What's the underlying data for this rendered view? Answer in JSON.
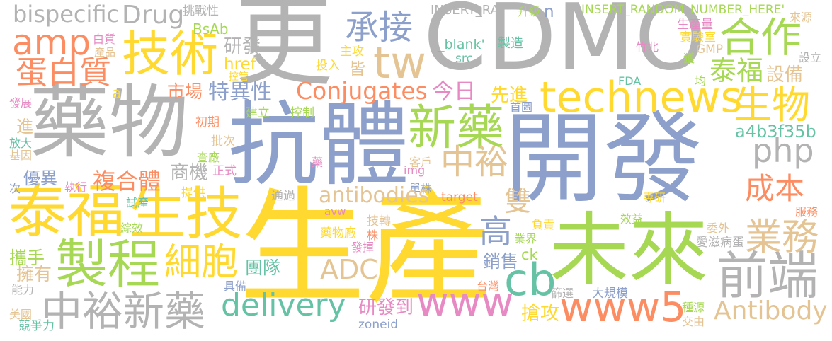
{
  "palette": {
    "gray": "#b3b3b3",
    "blue": "#8da0cb",
    "yellow": "#ffd92f",
    "green": "#a6d854",
    "orange": "#fc8d62",
    "tan": "#e5c494",
    "teal": "#66c2a5",
    "pink": "#e78ac3"
  },
  "words": [
    {
      "text": "更",
      "color": "#b3b3b3"
    },
    {
      "text": "CDMO",
      "color": "#b3b3b3"
    },
    {
      "text": "藥物",
      "color": "#b3b3b3"
    },
    {
      "text": "抗體",
      "color": "#8da0cb"
    },
    {
      "text": "開發",
      "color": "#8da0cb"
    },
    {
      "text": "生產",
      "color": "#ffd92f"
    },
    {
      "text": "未來",
      "color": "#a6d854"
    },
    {
      "text": "泰福",
      "color": "#ffd92f"
    },
    {
      "text": "生技",
      "color": "#ffd92f"
    },
    {
      "text": "製程",
      "color": "#a6d854"
    },
    {
      "text": "細胞",
      "color": "#ffd92f"
    },
    {
      "text": "中裕新藥",
      "color": "#b3b3b3"
    },
    {
      "text": "delivery",
      "color": "#66c2a5"
    },
    {
      "text": "www",
      "color": "#e78ac3"
    },
    {
      "text": "www5",
      "color": "#fc8d62"
    },
    {
      "text": "前端",
      "color": "#b3b3b3"
    },
    {
      "text": "業務",
      "color": "#e5c494"
    },
    {
      "text": "Antibody",
      "color": "#e5c494"
    },
    {
      "text": "成本",
      "color": "#fc8d62"
    },
    {
      "text": "php",
      "color": "#b3b3b3"
    },
    {
      "text": "a4b3f35b",
      "color": "#66c2a5"
    },
    {
      "text": "生物",
      "color": "#ffd92f"
    },
    {
      "text": "泰福",
      "color": "#a6d854"
    },
    {
      "text": "設備",
      "color": "#e5c494"
    },
    {
      "text": "合作",
      "color": "#a6d854"
    },
    {
      "text": "technews",
      "color": "#ffd92f"
    },
    {
      "text": "新藥",
      "color": "#a6d854"
    },
    {
      "text": "中裕",
      "color": "#e5c494"
    },
    {
      "text": "雙",
      "color": "#e5c494"
    },
    {
      "text": "高",
      "color": "#8da0cb"
    },
    {
      "text": "cb",
      "color": "#66c2a5"
    },
    {
      "text": "技術",
      "color": "#ffd92f"
    },
    {
      "text": "承接",
      "color": "#8da0cb"
    },
    {
      "text": "tw",
      "color": "#e5c494"
    },
    {
      "text": "amp",
      "color": "#fc8d62"
    },
    {
      "text": "蛋白質",
      "color": "#fc8d62"
    },
    {
      "text": "bispecific",
      "color": "#b3b3b3"
    },
    {
      "text": "Drug",
      "color": "#b3b3b3"
    },
    {
      "text": "挑戰性",
      "color": "#b3b3b3"
    },
    {
      "text": "BsAb",
      "color": "#a6d854"
    },
    {
      "text": "研發",
      "color": "#b3b3b3"
    },
    {
      "text": "白質",
      "color": "#e78ac3"
    },
    {
      "text": "產品",
      "color": "#e5c494"
    },
    {
      "text": "href",
      "color": "#ffd92f"
    },
    {
      "text": "控管",
      "color": "#ffd92f"
    },
    {
      "text": "市場",
      "color": "#fc8d62"
    },
    {
      "text": "特異性",
      "color": "#8da0cb"
    },
    {
      "text": "a",
      "color": "#ffd92f"
    },
    {
      "text": "發展",
      "color": "#e78ac3"
    },
    {
      "text": "進",
      "color": "#e5c494"
    },
    {
      "text": "放大",
      "color": "#66c2a5"
    },
    {
      "text": "基因",
      "color": "#e5c494"
    },
    {
      "text": "初期",
      "color": "#fc8d62"
    },
    {
      "text": "建立",
      "color": "#a6d854"
    },
    {
      "text": "控制",
      "color": "#a6d854"
    },
    {
      "text": "批次",
      "color": "#e5c494"
    },
    {
      "text": "查廠",
      "color": "#a6d854"
    },
    {
      "text": "商機",
      "color": "#b3b3b3"
    },
    {
      "text": "正式",
      "color": "#e78ac3"
    },
    {
      "text": "藥",
      "color": "#e78ac3"
    },
    {
      "text": "提供",
      "color": "#ffd92f"
    },
    {
      "text": "通過",
      "color": "#b3b3b3"
    },
    {
      "text": "客戶",
      "color": "#e5c494"
    },
    {
      "text": "img",
      "color": "#e78ac3"
    },
    {
      "text": "單株",
      "color": "#8da0cb"
    },
    {
      "text": "target",
      "color": "#fc8d62"
    },
    {
      "text": "antibodies",
      "color": "#e5c494"
    },
    {
      "text": "avw",
      "color": "#e78ac3"
    },
    {
      "text": "技轉",
      "color": "#e5c494"
    },
    {
      "text": "藥物廠",
      "color": "#ffd92f"
    },
    {
      "text": "株",
      "color": "#fc8d62"
    },
    {
      "text": "發揮",
      "color": "#e78ac3"
    },
    {
      "text": "ADC",
      "color": "#e5c494"
    },
    {
      "text": "團隊",
      "color": "#66c2a5"
    },
    {
      "text": "銷售",
      "color": "#8da0cb"
    },
    {
      "text": "ck",
      "color": "#a6d854"
    },
    {
      "text": "業界",
      "color": "#a6d854"
    },
    {
      "text": "負責",
      "color": "#ffd92f"
    },
    {
      "text": "台灣",
      "color": "#fc8d62"
    },
    {
      "text": "研發到",
      "color": "#e78ac3"
    },
    {
      "text": "zoneid",
      "color": "#8da0cb"
    },
    {
      "text": "搶攻",
      "color": "#ffd92f"
    },
    {
      "text": "篩選",
      "color": "#b3b3b3"
    },
    {
      "text": "大規模",
      "color": "#8da0cb"
    },
    {
      "text": "種源",
      "color": "#a6d854"
    },
    {
      "text": "交由",
      "color": "#e5c494"
    },
    {
      "text": "效益",
      "color": "#a6d854"
    },
    {
      "text": "專研",
      "color": "#ffd92f"
    },
    {
      "text": "服務",
      "color": "#fc8d62"
    },
    {
      "text": "委外",
      "color": "#e5c494"
    },
    {
      "text": "愛滋病蛋",
      "color": "#b3b3b3"
    },
    {
      "text": "優異",
      "color": "#8da0cb"
    },
    {
      "text": "次",
      "color": "#8da0cb"
    },
    {
      "text": "執行",
      "color": "#e78ac3"
    },
    {
      "text": "複合體",
      "color": "#fc8d62"
    },
    {
      "text": "試產",
      "color": "#66c2a5"
    },
    {
      "text": "綜效",
      "color": "#a6d854"
    },
    {
      "text": "攜手",
      "color": "#a6d854"
    },
    {
      "text": "擁有",
      "color": "#e5c494"
    },
    {
      "text": "能力",
      "color": "#b3b3b3"
    },
    {
      "text": "具備",
      "color": "#8da0cb"
    },
    {
      "text": "美國",
      "color": "#e5c494"
    },
    {
      "text": "競爭力",
      "color": "#66c2a5"
    },
    {
      "text": "INSERT_RA",
      "color": "#b3b3b3"
    },
    {
      "text": "升級",
      "color": "#a6d854"
    },
    {
      "text": "n",
      "color": "#8da0cb"
    },
    {
      "text": "INSERT_RANDOM_NUMBER_HERE'",
      "color": "#a6d854"
    },
    {
      "text": "來源",
      "color": "#e5c494"
    },
    {
      "text": "生產量",
      "color": "#e78ac3"
    },
    {
      "text": "實驗室",
      "color": "#ffd92f"
    },
    {
      "text": "竹北",
      "color": "#e78ac3"
    },
    {
      "text": "GMP",
      "color": "#e5c494"
    },
    {
      "text": "獲",
      "color": "#a6d854"
    },
    {
      "text": "設立",
      "color": "#b3b3b3"
    },
    {
      "text": "FDA",
      "color": "#66c2a5"
    },
    {
      "text": "均",
      "color": "#a6d854"
    },
    {
      "text": "_blank'",
      "color": "#66c2a5"
    },
    {
      "text": "src",
      "color": "#66c2a5"
    },
    {
      "text": "製造",
      "color": "#66c2a5"
    },
    {
      "text": "主攻",
      "color": "#ffd92f"
    },
    {
      "text": "投入",
      "color": "#ffd92f"
    },
    {
      "text": "皆",
      "color": "#e5c494"
    },
    {
      "text": "Conjugates",
      "color": "#fc8d62"
    },
    {
      "text": "今日",
      "color": "#e78ac3"
    },
    {
      "text": "先進",
      "color": "#ffd92f"
    },
    {
      "text": "首圖",
      "color": "#8da0cb"
    }
  ]
}
